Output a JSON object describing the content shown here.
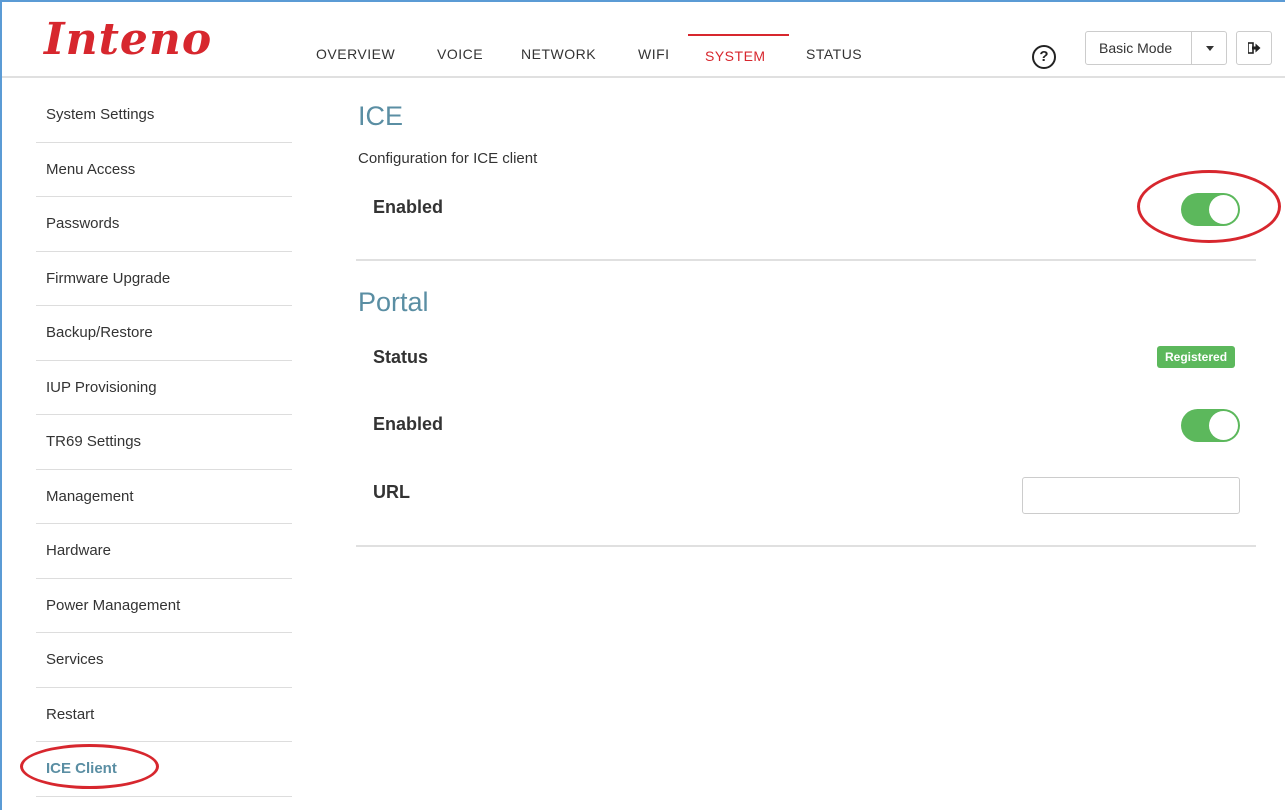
{
  "brand": {
    "logo_text": "Inteno",
    "accent_color": "#d7272e",
    "heading_color": "#5a8ea3",
    "toggle_color": "#5cb85c"
  },
  "header": {
    "nav": [
      {
        "label": "OVERVIEW",
        "active": false
      },
      {
        "label": "VOICE",
        "active": false
      },
      {
        "label": "NETWORK",
        "active": false
      },
      {
        "label": "WIFI",
        "active": false
      },
      {
        "label": "SYSTEM",
        "active": true
      },
      {
        "label": "STATUS",
        "active": false
      }
    ],
    "help_glyph": "?",
    "mode_select": {
      "value": "Basic Mode"
    }
  },
  "sidebar": {
    "items": [
      {
        "label": "System Settings"
      },
      {
        "label": "Menu Access"
      },
      {
        "label": "Passwords"
      },
      {
        "label": "Firmware Upgrade"
      },
      {
        "label": "Backup/Restore"
      },
      {
        "label": "IUP Provisioning"
      },
      {
        "label": "TR69 Settings"
      },
      {
        "label": "Management"
      },
      {
        "label": "Hardware"
      },
      {
        "label": "Power Management"
      },
      {
        "label": "Services"
      },
      {
        "label": "Restart"
      },
      {
        "label": "ICE Client",
        "active": true
      }
    ]
  },
  "ice": {
    "title": "ICE",
    "description": "Configuration for ICE client",
    "enabled_label": "Enabled",
    "enabled": true
  },
  "portal": {
    "title": "Portal",
    "status_label": "Status",
    "status_value": "Registered",
    "enabled_label": "Enabled",
    "enabled": true,
    "url_label": "URL",
    "url_value": ""
  }
}
